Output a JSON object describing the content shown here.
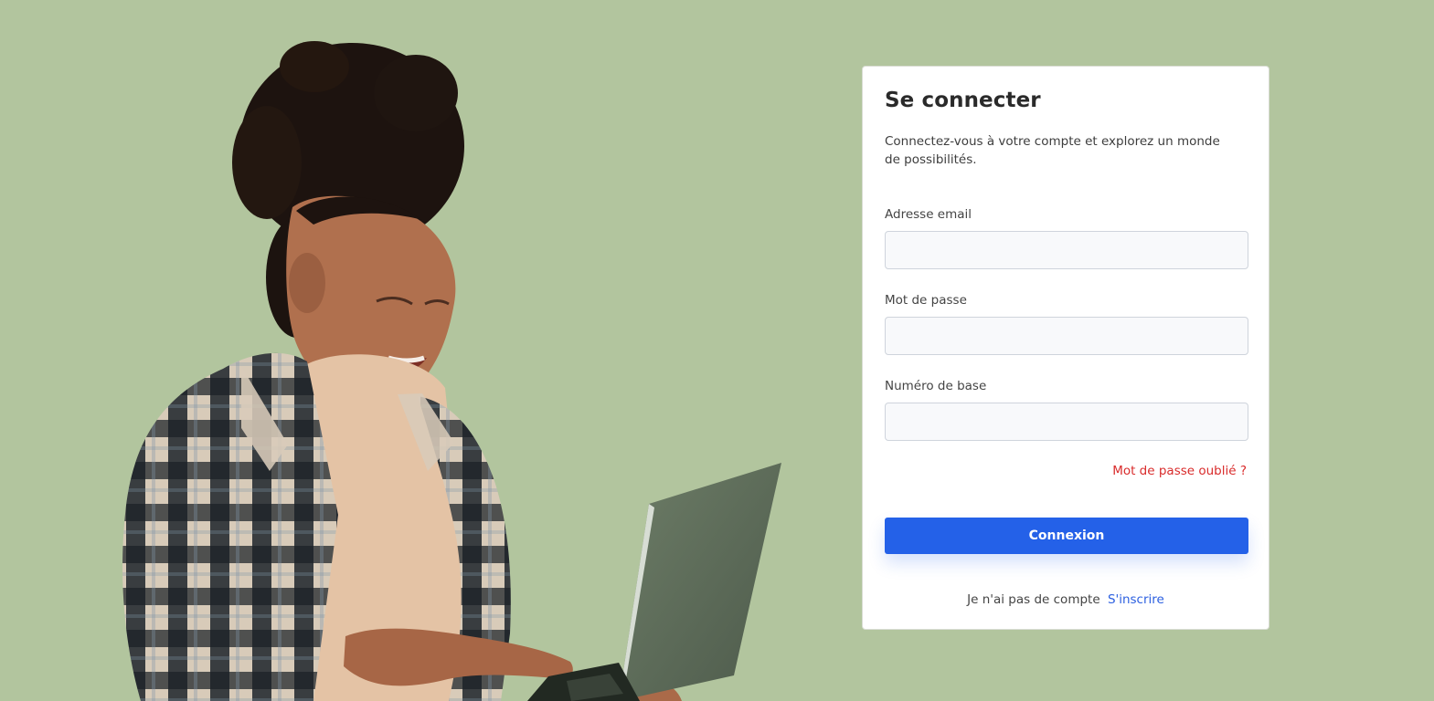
{
  "colors": {
    "background": "#b2c59e",
    "primary": "#2461e8",
    "danger_link": "#d92b2b",
    "signup_link": "#2b5fe0"
  },
  "hero": {
    "image": "student-with-laptop"
  },
  "login": {
    "title": "Se connecter",
    "subtitle": "Connectez-vous à votre compte et explorez un monde de possibilités.",
    "fields": [
      {
        "label": "Adresse email",
        "value": "",
        "placeholder": ""
      },
      {
        "label": "Mot de passe",
        "value": "",
        "placeholder": ""
      },
      {
        "label": "Numéro de base",
        "value": "",
        "placeholder": ""
      }
    ],
    "forgot_password": "Mot de passe oublié ?",
    "submit_label": "Connexion",
    "signup_prompt": "Je n'ai pas de compte",
    "signup_link": "S'inscrire"
  }
}
